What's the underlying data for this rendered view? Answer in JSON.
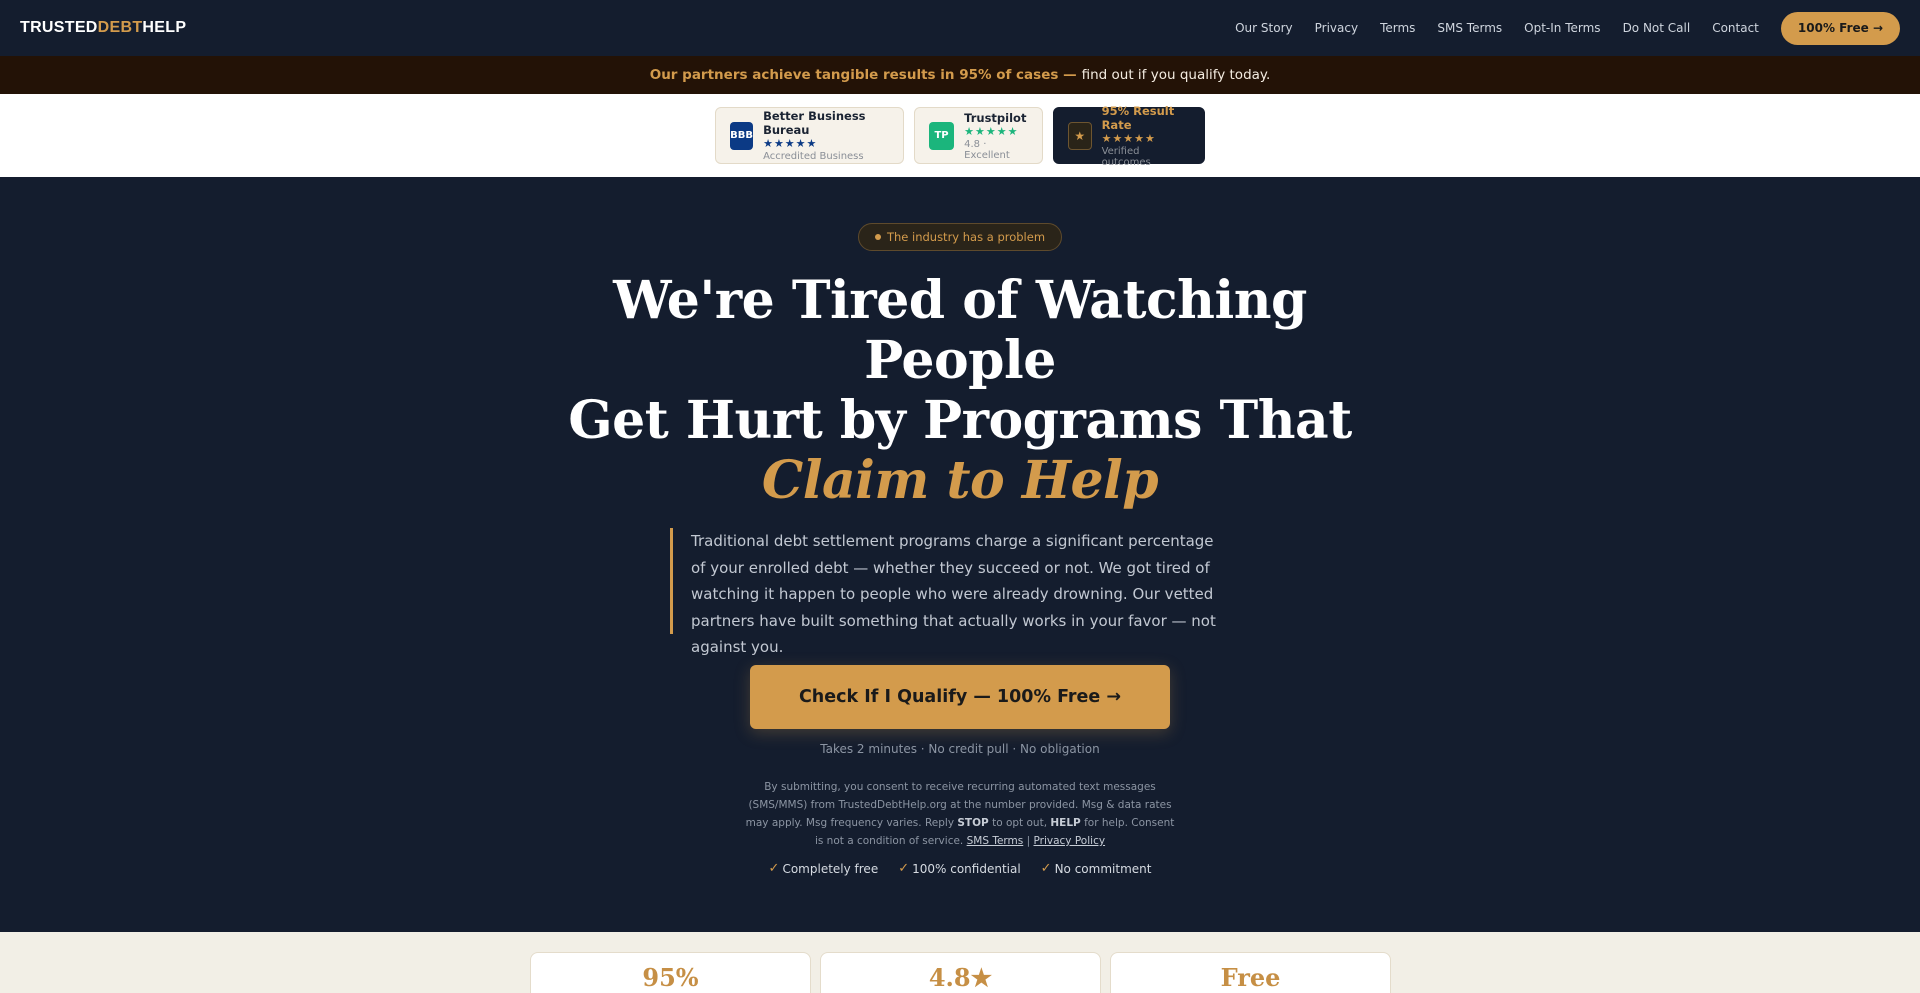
{
  "nav": {
    "logo": {
      "part1": "TRUSTED",
      "part2": "DEBT",
      "part3": "HELP"
    },
    "links": [
      "Our Story",
      "Privacy",
      "Terms",
      "SMS Terms",
      "Opt-In Terms",
      "Do Not Call",
      "Contact"
    ],
    "cta": "100% Free →"
  },
  "announcement": {
    "highlight": "Our partners achieve tangible results in 95% of cases —",
    "rest": "find out if you qualify today."
  },
  "badges": {
    "bbb": {
      "icon": "BBB",
      "title": "Better Business Bureau",
      "stars": "★★★★★",
      "sub": "Accredited Business"
    },
    "trustpilot": {
      "icon": "TP",
      "title": "Trustpilot",
      "stars": "★★★★★",
      "sub": "4.8 · Excellent"
    },
    "result": {
      "icon": "★",
      "title": "95% Result Rate",
      "stars": "★★★★★",
      "sub": "Verified outcomes"
    }
  },
  "hero": {
    "pill": "The industry has a problem",
    "headline": {
      "line1": "We're Tired of Watching",
      "line2": "People",
      "line3": "Get Hurt by Programs That",
      "line4": "Claim to Help"
    },
    "quote": "Traditional debt settlement programs charge a significant percentage of your enrolled debt — whether they succeed or not. We got tired of watching it happen to people who were already drowning. Our vetted partners have built something that actually works in your favor — not against you.",
    "cta": "Check If I Qualify — 100% Free →",
    "takes": "Takes 2 minutes · No credit pull · No obligation",
    "consent": {
      "part1": "By submitting, you consent to receive recurring automated text messages (SMS/MMS) from TrustedDebtHelp.org at the number provided. Msg & data rates may apply. Msg frequency varies. Reply",
      "stop": "STOP",
      "part2": "to opt out,",
      "help": "HELP",
      "part3": "for help. Consent is not a condition of service.",
      "sms_link": "SMS Terms",
      "sep": "|",
      "privacy_link": "Privacy Policy"
    },
    "checks": [
      "Completely free",
      "100% confidential",
      "No commitment"
    ]
  },
  "stats": [
    "95%",
    "4.8★",
    "Free"
  ],
  "colors": {
    "accent": "#d39b4c",
    "navy": "#141d2e",
    "announce_bg": "#231206"
  }
}
